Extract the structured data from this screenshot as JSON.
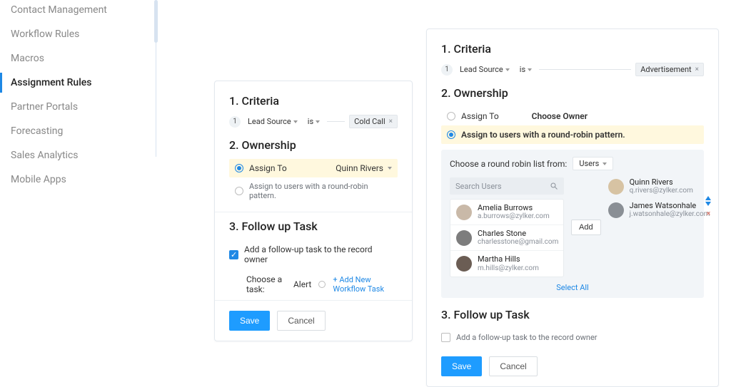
{
  "sidebar": {
    "items": [
      {
        "label": "Contact Management"
      },
      {
        "label": "Workflow Rules"
      },
      {
        "label": "Macros"
      },
      {
        "label": "Assignment Rules"
      },
      {
        "label": "Partner Portals"
      },
      {
        "label": "Forecasting"
      },
      {
        "label": "Sales Analytics"
      },
      {
        "label": "Mobile Apps"
      }
    ],
    "active_index": 3
  },
  "panel_left": {
    "criteria": {
      "title": "1. Criteria",
      "num": "1",
      "field": "Lead Source",
      "operator": "is",
      "value_chip": "Cold Call"
    },
    "ownership": {
      "title": "2. Ownership",
      "assign_to_label": "Assign To",
      "owner_value": "Quinn Rivers",
      "round_robin_label": "Assign to users with a round-robin pattern."
    },
    "followup": {
      "title": "3. Follow up Task",
      "checkbox_label": "Add a follow-up task to the record owner",
      "choose_label": "Choose a task:",
      "task_value": "Alert",
      "add_label": "+ Add New Workflow Task"
    },
    "buttons": {
      "save": "Save",
      "cancel": "Cancel"
    }
  },
  "panel_right": {
    "criteria": {
      "title": "1. Criteria",
      "num": "1",
      "field": "Lead Source",
      "operator": "is",
      "value_chip": "Advertisement"
    },
    "ownership": {
      "title": "2. Ownership",
      "assign_to_label": "Assign To",
      "choose_owner": "Choose Owner",
      "round_robin_label": "Assign to users with a round-robin pattern.",
      "rr_head": "Choose a round robin list from:",
      "rr_from": "Users",
      "search_placeholder": "Search Users",
      "users": [
        {
          "name": "Amelia Burrows",
          "email": "a.burrows@zylker.com",
          "avatar": "#c9b9a8"
        },
        {
          "name": "Charles Stone",
          "email": "charlesstone@gmail.com",
          "avatar": "#7d7d7d"
        },
        {
          "name": "Martha Hills",
          "email": "m.hills@zylker.com",
          "avatar": "#6b5d54"
        }
      ],
      "add_btn": "Add",
      "selected": [
        {
          "name": "Quinn Rivers",
          "email": "q.rivers@zylker.com",
          "avatar": "#d7c3a3"
        },
        {
          "name": "James Watsonhale",
          "email": "j.watsonhale@zylker.com",
          "avatar": "#8a8f95"
        }
      ],
      "select_all": "Select All"
    },
    "followup": {
      "title": "3. Follow up Task",
      "checkbox_label": "Add a follow-up task to the record owner"
    },
    "buttons": {
      "save": "Save",
      "cancel": "Cancel"
    }
  }
}
